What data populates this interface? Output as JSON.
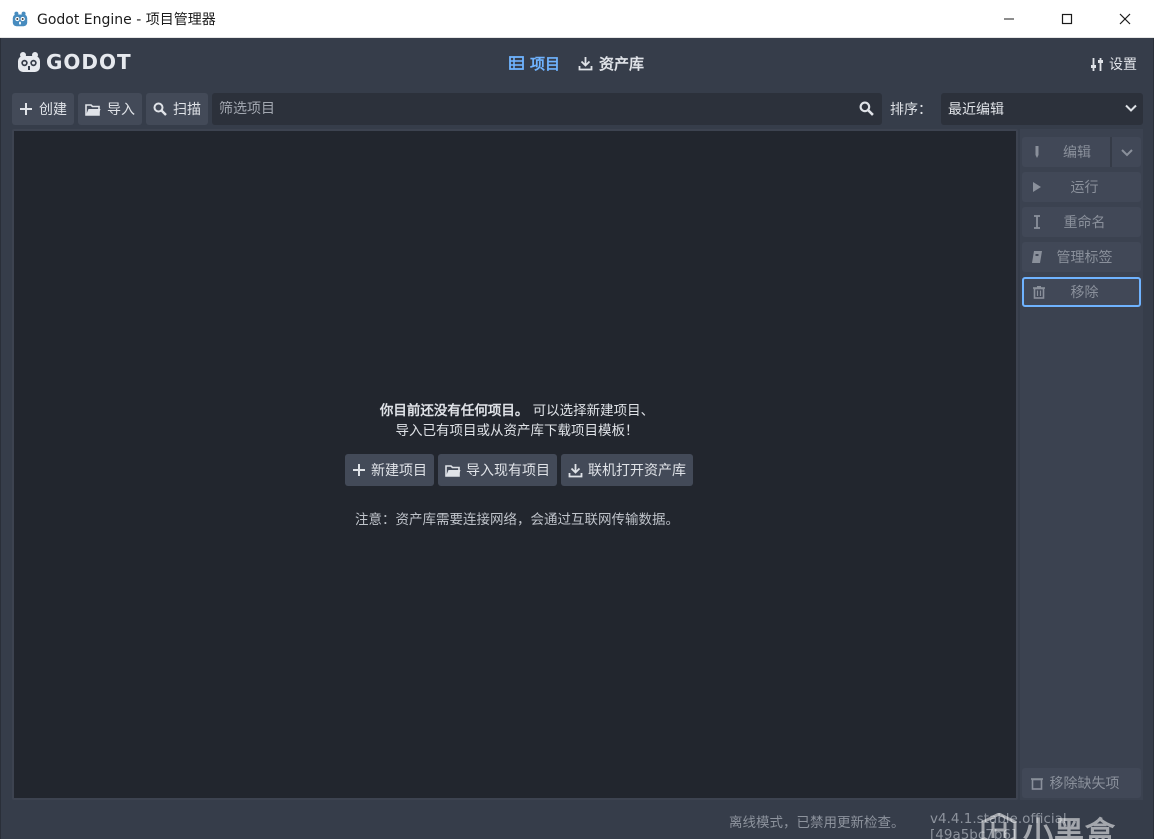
{
  "window": {
    "title": "Godot Engine - 项目管理器"
  },
  "header": {
    "logo_text": "GODOT",
    "tabs": [
      {
        "label": "项目",
        "active": true
      },
      {
        "label": "资产库",
        "active": false
      }
    ],
    "settings_label": "设置"
  },
  "toolbar": {
    "create_label": "创建",
    "import_label": "导入",
    "scan_label": "扫描",
    "filter_placeholder": "筛选项目",
    "filter_value": "",
    "sort_label": "排序：",
    "sort_value": "最近编辑"
  },
  "empty_state": {
    "message_bold": "你目前还没有任何项目。",
    "message_rest": "可以选择新建项目、",
    "message_line2": "导入已有项目或从资产库下载项目模板！",
    "buttons": {
      "new_project": "新建项目",
      "import_existing": "导入现有项目",
      "open_asset_library": "联机打开资产库"
    },
    "note": "注意：资产库需要连接网络，会通过互联网传输数据。"
  },
  "side_actions": {
    "edit": "编辑",
    "run": "运行",
    "rename": "重命名",
    "manage_tags": "管理标签",
    "remove": "移除",
    "remove_missing": "移除缺失项"
  },
  "footer": {
    "offline_status": "离线模式，已禁用更新检查。",
    "version": "v4.4.1.stable.official [49a5bc7b6]"
  },
  "watermark": {
    "text": "小黑盒"
  },
  "colors": {
    "accent": "#6fb3ff",
    "background": "#363d4a",
    "panel": "#22262e",
    "button": "#434a58"
  }
}
